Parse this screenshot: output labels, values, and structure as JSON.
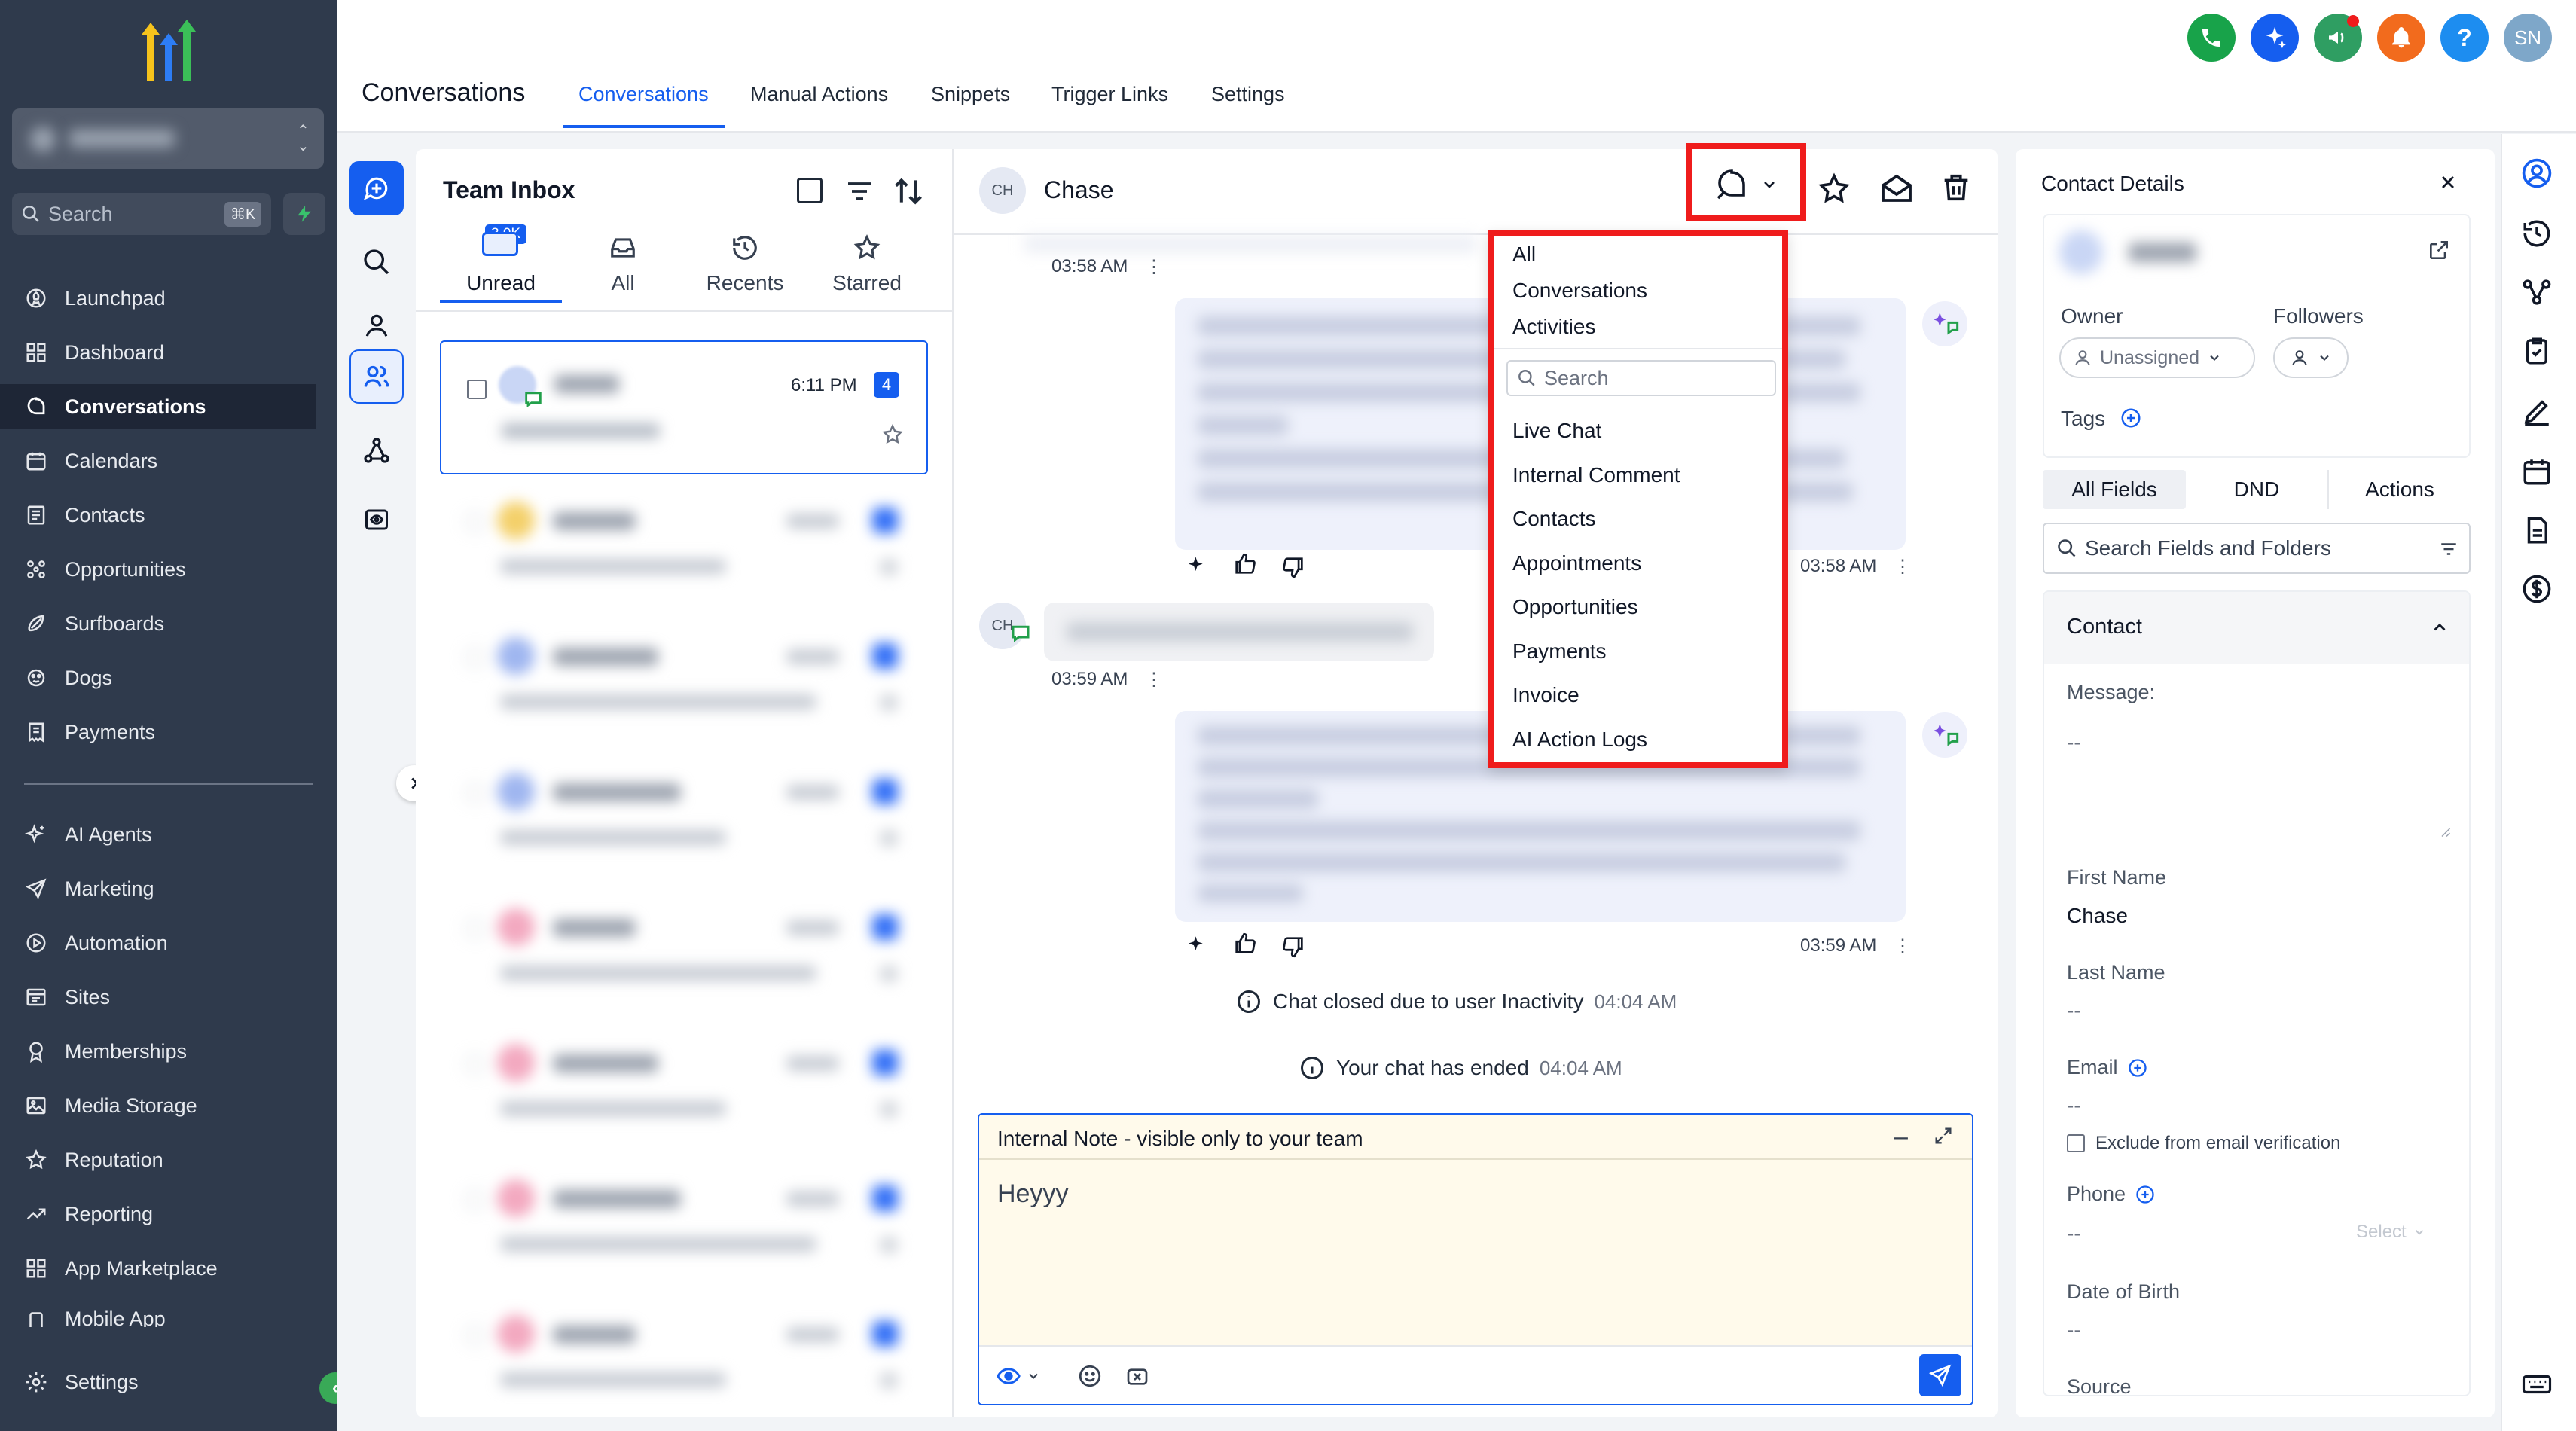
{
  "sidebar": {
    "search_placeholder": "Search",
    "search_shortcut": "⌘K",
    "items": [
      {
        "label": "Launchpad",
        "icon": "rocket-icon"
      },
      {
        "label": "Dashboard",
        "icon": "grid-icon"
      },
      {
        "label": "Conversations",
        "icon": "chat-icon",
        "active": true
      },
      {
        "label": "Calendars",
        "icon": "calendar-icon"
      },
      {
        "label": "Contacts",
        "icon": "contact-card-icon"
      },
      {
        "label": "Opportunities",
        "icon": "opportunities-icon"
      },
      {
        "label": "Surfboards",
        "icon": "surfboard-icon"
      },
      {
        "label": "Dogs",
        "icon": "paw-icon"
      },
      {
        "label": "Payments",
        "icon": "receipt-icon"
      }
    ],
    "items2": [
      {
        "label": "AI Agents",
        "icon": "sparkle-icon"
      },
      {
        "label": "Marketing",
        "icon": "send-icon"
      },
      {
        "label": "Automation",
        "icon": "play-circle-icon"
      },
      {
        "label": "Sites",
        "icon": "browser-icon"
      },
      {
        "label": "Memberships",
        "icon": "award-icon"
      },
      {
        "label": "Media Storage",
        "icon": "image-icon"
      },
      {
        "label": "Reputation",
        "icon": "star-icon"
      },
      {
        "label": "Reporting",
        "icon": "trend-icon"
      },
      {
        "label": "App Marketplace",
        "icon": "apps-icon"
      },
      {
        "label": "Mobile App",
        "icon": "mobile-icon"
      }
    ],
    "settings_label": "Settings"
  },
  "header": {
    "title": "Conversations",
    "tabs": [
      "Conversations",
      "Manual Actions",
      "Snippets",
      "Trigger Links",
      "Settings"
    ],
    "avatar": "SN",
    "help": "?"
  },
  "inbox": {
    "title": "Team Inbox",
    "tabs": [
      {
        "label": "Unread",
        "badge": "3.0K"
      },
      {
        "label": "All"
      },
      {
        "label": "Recents"
      },
      {
        "label": "Starred"
      }
    ],
    "first_item": {
      "time": "6:11 PM",
      "count": "4"
    }
  },
  "chat": {
    "avatar": "CH",
    "contact_name": "Chase",
    "messages": [
      {
        "time": "03:58 AM"
      },
      {
        "time": "03:58 AM"
      },
      {
        "time": "03:59 AM"
      },
      {
        "time": "03:59 AM"
      }
    ],
    "events": [
      {
        "text": "Chat closed due to user Inactivity",
        "time": "04:04 AM"
      },
      {
        "text": "Your chat has ended",
        "time": "04:04 AM"
      }
    ],
    "composer": {
      "title": "Internal Note - visible only to your team",
      "text": "Heyyy"
    }
  },
  "filter_menu": {
    "items_top": [
      "All",
      "Conversations",
      "Activities"
    ],
    "search_placeholder": "Search",
    "items": [
      "Live Chat",
      "Internal Comment",
      "Contacts",
      "Appointments",
      "Opportunities",
      "Payments",
      "Invoice",
      "AI Action Logs"
    ]
  },
  "contact": {
    "title": "Contact Details",
    "owner_label": "Owner",
    "followers_label": "Followers",
    "owner_value": "Unassigned",
    "tags_label": "Tags",
    "tabs": [
      "All Fields",
      "DND",
      "Actions"
    ],
    "search_placeholder": "Search Fields and Folders",
    "section": "Contact",
    "message_label": "Message:",
    "message_value": "--",
    "first_name_label": "First Name",
    "first_name": "Chase",
    "last_name_label": "Last Name",
    "last_name": "--",
    "email_label": "Email",
    "email": "--",
    "exclude_label": "Exclude from email verification",
    "phone_label": "Phone",
    "phone": "--",
    "phone_select": "Select",
    "dob_label": "Date of Birth",
    "dob": "--",
    "source_label": "Source"
  },
  "colors": {
    "sidebar_bg": "#2f3a4c",
    "accent": "#155eef",
    "highlight": "#ef1c1c",
    "note_bg": "#fffaeb"
  }
}
